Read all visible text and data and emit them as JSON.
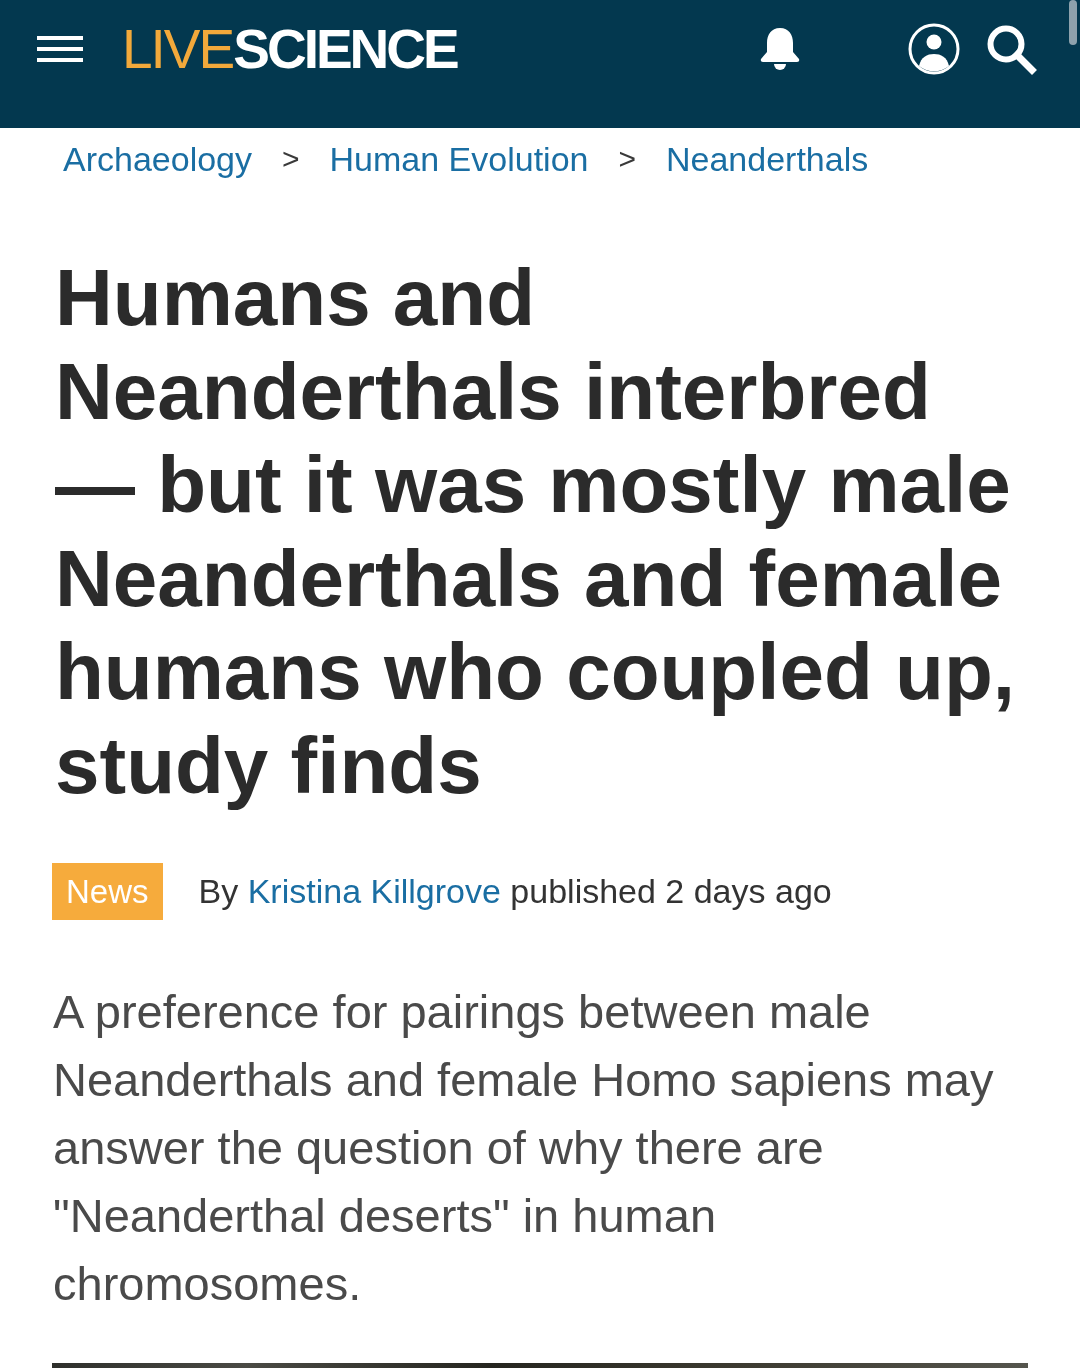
{
  "header": {
    "logo": {
      "light": "LIVE",
      "bold": "SCIENCE"
    }
  },
  "breadcrumbs": [
    {
      "kind": "link",
      "text": "Archaeology"
    },
    {
      "kind": "separator",
      "text": ">"
    },
    {
      "kind": "link",
      "text": "Human Evolution"
    },
    {
      "kind": "separator",
      "text": ">"
    },
    {
      "kind": "link",
      "text": "Neanderthals"
    }
  ],
  "article": {
    "title": "Humans and Neanderthals interbred — but it was mostly male Neanderthals and female humans who coupled up, study finds",
    "category": "News",
    "byline": {
      "prefix": "By",
      "author": "Kristina Killgrove",
      "suffix": "published 2 days ago"
    },
    "standfirst": "A preference for pairings between male Neanderthals and female Homo sapiens may answer the question of why there are \"Neanderthal deserts\" in human chromosomes."
  }
}
